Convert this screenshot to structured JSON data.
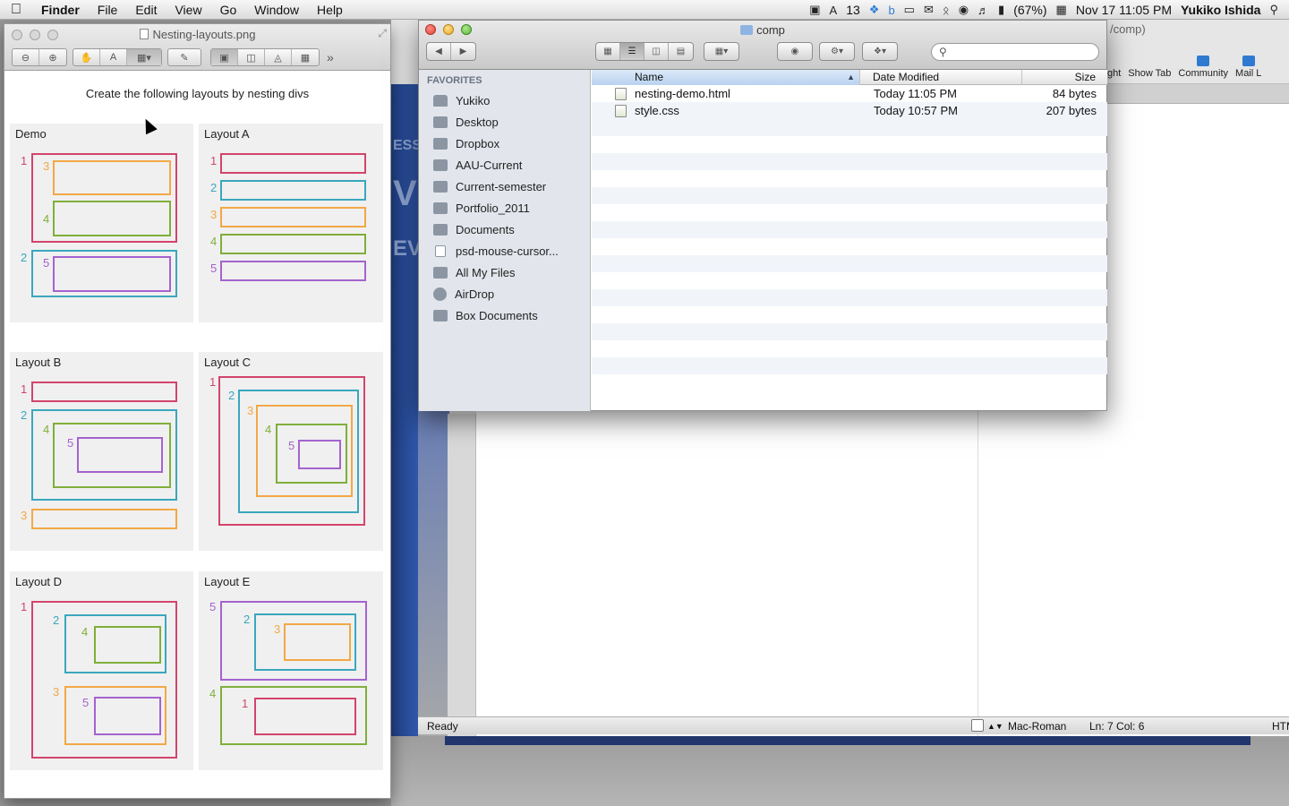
{
  "menubar": {
    "apple": "",
    "app": "Finder",
    "items": [
      "File",
      "Edit",
      "View",
      "Go",
      "Window",
      "Help"
    ],
    "status_badge": "13",
    "battery": "(67%)",
    "datetime": "Nov 17  11:05 PM",
    "user": "Yukiko Ishida"
  },
  "preview": {
    "title": "Nesting-layouts.png",
    "heading": "Create the following layouts by nesting divs",
    "panels": {
      "demo": "Demo",
      "a": "Layout A",
      "b": "Layout B",
      "c": "Layout C",
      "d": "Layout D",
      "e": "Layout E"
    },
    "numbers": {
      "one": "1",
      "two": "2",
      "three": "3",
      "four": "4",
      "five": "5"
    },
    "colors": {
      "1": "#d2446c",
      "2": "#3aa7bd",
      "3": "#f2a846",
      "4": "#7faf3a",
      "5": "#a463cf"
    }
  },
  "finder": {
    "title": "comp",
    "search_placeholder": "",
    "sidebar_section": "FAVORITES",
    "sidebar": [
      "Yukiko",
      "Desktop",
      "Dropbox",
      "AAU-Current",
      "Current-semester",
      "Portfolio_2011",
      "Documents",
      "psd-mouse-cursor...",
      "All My Files",
      "AirDrop",
      "Box Documents"
    ],
    "columns": {
      "name": "Name",
      "date": "Date Modified",
      "size": "Size"
    },
    "files": [
      {
        "name": "nesting-demo.html",
        "date": "Today 11:05 PM",
        "size": "84 bytes"
      },
      {
        "name": "style.css",
        "date": "Today 10:57 PM",
        "size": "207 bytes"
      }
    ]
  },
  "editor": {
    "path": "/comp)",
    "tools": {
      "light": "ght",
      "show_tab": "Show Tab",
      "community": "Community",
      "mail": "Mail L"
    },
    "status": {
      "ready": "Ready",
      "encoding": "Mac-Roman",
      "position": "Ln: 7 Col: 6",
      "lang": "HTM"
    },
    "art_words": [
      "ESS",
      "V",
      "EV"
    ]
  }
}
